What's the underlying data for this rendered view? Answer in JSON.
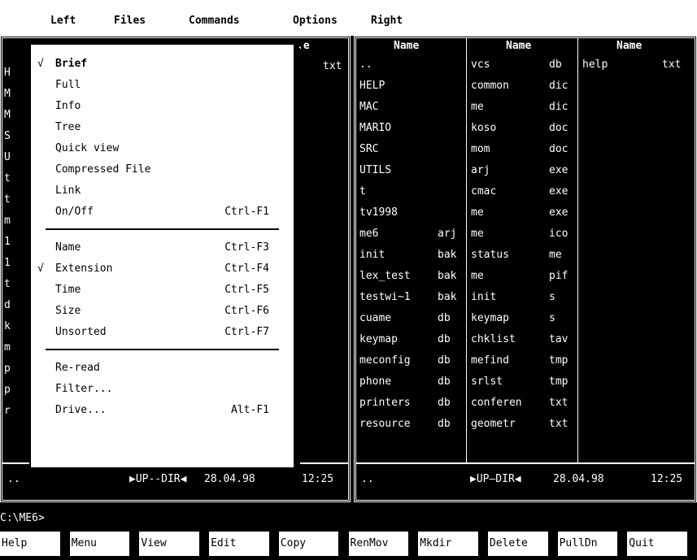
{
  "menubar": {
    "items": [
      "Left",
      "Files",
      "Commands",
      "Options",
      "Right"
    ]
  },
  "left_panel": {
    "partial_top_ext": "txt",
    "partial_header": ".e",
    "left_edge_chars": [
      "H",
      "M",
      "M",
      "S",
      "U",
      "t",
      "t",
      "m",
      "1",
      "1",
      "t",
      "d",
      "k",
      "m",
      "p",
      "p",
      "r"
    ],
    "status": {
      "name": "..",
      "info": "▶UP--DIR◀",
      "date": "28.04.98",
      "time": "12:25"
    }
  },
  "right_panel": {
    "headers": [
      "Name",
      "Name",
      "Name"
    ],
    "col1": [
      {
        "name": "..",
        "ext": ""
      },
      {
        "name": "HELP",
        "ext": ""
      },
      {
        "name": "MAC",
        "ext": ""
      },
      {
        "name": "MARIO",
        "ext": ""
      },
      {
        "name": "SRC",
        "ext": ""
      },
      {
        "name": "UTILS",
        "ext": ""
      },
      {
        "name": "t",
        "ext": ""
      },
      {
        "name": "tv1998",
        "ext": ""
      },
      {
        "name": "me6",
        "ext": "arj"
      },
      {
        "name": "init",
        "ext": "bak"
      },
      {
        "name": "lex_test",
        "ext": "bak"
      },
      {
        "name": "testwi~1",
        "ext": "bak"
      },
      {
        "name": "cuame",
        "ext": "db"
      },
      {
        "name": "keymap",
        "ext": "db"
      },
      {
        "name": "meconfig",
        "ext": "db"
      },
      {
        "name": "phone",
        "ext": "db"
      },
      {
        "name": "printers",
        "ext": "db"
      },
      {
        "name": "resource",
        "ext": "db"
      }
    ],
    "col2": [
      {
        "name": "vcs",
        "ext": "db"
      },
      {
        "name": "common",
        "ext": "dic"
      },
      {
        "name": "me",
        "ext": "dic"
      },
      {
        "name": "koso",
        "ext": "doc"
      },
      {
        "name": "mom",
        "ext": "doc"
      },
      {
        "name": "arj",
        "ext": "exe"
      },
      {
        "name": "cmac",
        "ext": "exe"
      },
      {
        "name": "me",
        "ext": "exe"
      },
      {
        "name": "me",
        "ext": "ico"
      },
      {
        "name": "status",
        "ext": "me"
      },
      {
        "name": "me",
        "ext": "pif"
      },
      {
        "name": "init",
        "ext": "s"
      },
      {
        "name": "keymap",
        "ext": "s"
      },
      {
        "name": "chklist",
        "ext": "tav"
      },
      {
        "name": "mefind",
        "ext": "tmp"
      },
      {
        "name": "srlst",
        "ext": "tmp"
      },
      {
        "name": "conferen",
        "ext": "txt"
      },
      {
        "name": "geometr",
        "ext": "txt"
      }
    ],
    "col3": [
      {
        "name": "help",
        "ext": "txt"
      }
    ],
    "status": {
      "name": "..",
      "info": "▶UP—DIR◀",
      "date": "28.04.98",
      "time": "12:25"
    }
  },
  "dropdown": {
    "group1": [
      {
        "check": "√",
        "label": "Brief",
        "shortcut": ""
      },
      {
        "check": "",
        "label": "Full",
        "shortcut": ""
      },
      {
        "check": "",
        "label": "Info",
        "shortcut": ""
      },
      {
        "check": "",
        "label": "Tree",
        "shortcut": ""
      },
      {
        "check": "",
        "label": "Quick view",
        "shortcut": ""
      },
      {
        "check": "",
        "label": "Compressed File",
        "shortcut": ""
      },
      {
        "check": "",
        "label": "Link",
        "shortcut": ""
      },
      {
        "check": "",
        "label": "On/Off",
        "shortcut": "Ctrl-F1"
      }
    ],
    "group2": [
      {
        "check": "",
        "label": "Name",
        "shortcut": "Ctrl-F3"
      },
      {
        "check": "√",
        "label": "Extension",
        "shortcut": "Ctrl-F4"
      },
      {
        "check": "",
        "label": "Time",
        "shortcut": "Ctrl-F5"
      },
      {
        "check": "",
        "label": "Size",
        "shortcut": "Ctrl-F6"
      },
      {
        "check": "",
        "label": "Unsorted",
        "shortcut": "Ctrl-F7"
      }
    ],
    "group3": [
      {
        "check": "",
        "label": "Re-read",
        "shortcut": ""
      },
      {
        "check": "",
        "label": "Filter...",
        "shortcut": ""
      },
      {
        "check": "",
        "label": "Drive...",
        "shortcut": "Alt-F1"
      }
    ]
  },
  "cmdline": "C:\\ME6>",
  "fkeys": [
    "Help",
    "Menu",
    "View",
    "Edit",
    "Copy",
    "RenMov",
    "Mkdir",
    "Delete",
    "PullDn",
    "Quit"
  ]
}
